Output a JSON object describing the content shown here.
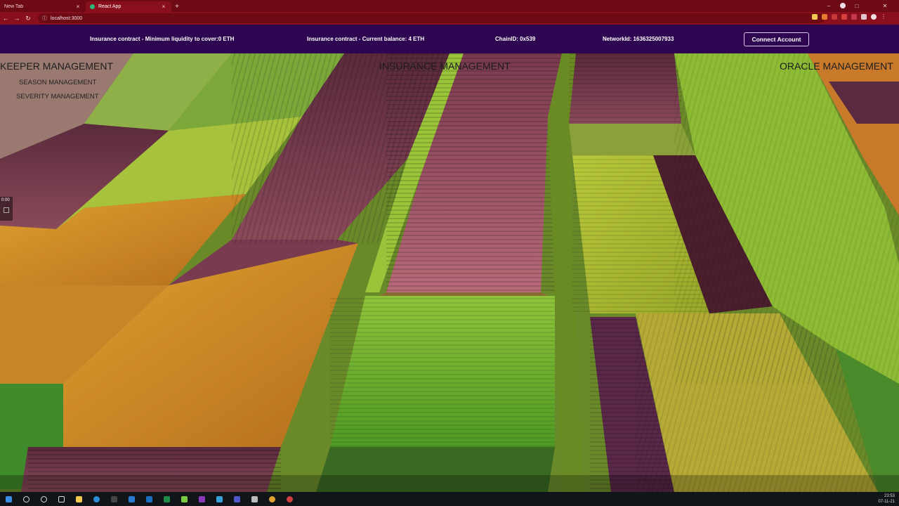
{
  "browser": {
    "tabs": [
      {
        "title": "New Tab",
        "active": false
      },
      {
        "title": "React App",
        "active": true
      }
    ],
    "address": "localhost:3000",
    "new_tab_glyph": "+",
    "close_glyph": "×"
  },
  "header": {
    "min_liquidity": "Insurance contract - Minimum liquidity to cover:0 ETH",
    "current_balance": "Insurance contract - Current balance: 4 ETH",
    "chain_id": "ChainID: 0x539",
    "network_id": "NetworkId: 1636325007933",
    "connect_label": "Connect Account"
  },
  "nav": {
    "keeper": {
      "title": "KEEPER MANAGEMENT",
      "items": [
        "SEASON MANAGEMENT",
        "SEVERITY MANAGEMENT"
      ]
    },
    "insurance": {
      "title": "INSURANCE MANAGEMENT"
    },
    "oracle": {
      "title": "ORACLE MANAGEMENT"
    }
  },
  "video": {
    "time": "0:00"
  },
  "taskbar": {
    "time": "23:53",
    "date": "07-11-21"
  },
  "colors": {
    "header_bg": "#2d0550",
    "chrome_tab": "#6e0a14",
    "chrome_toolbar": "#8a0f1c"
  }
}
